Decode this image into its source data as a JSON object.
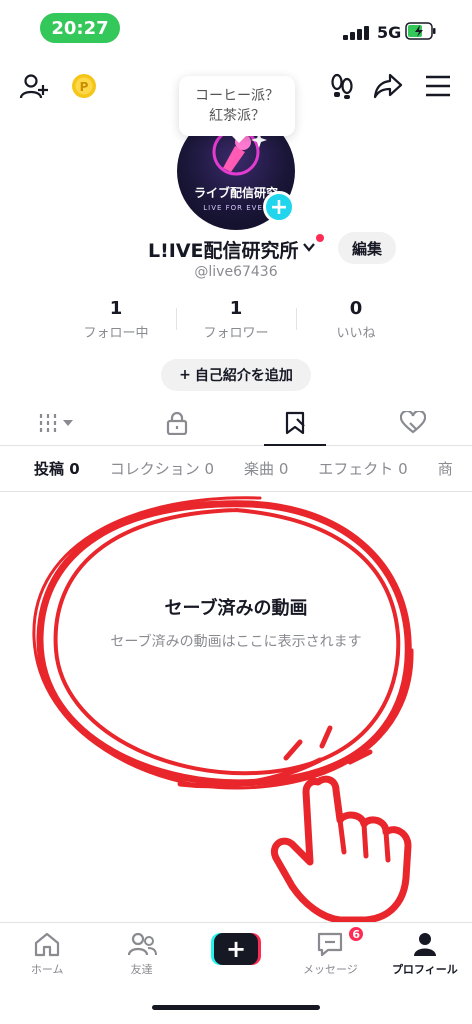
{
  "status_bar": {
    "time": "20:27",
    "network": "5G"
  },
  "bubble": {
    "line1": "コーヒー派？",
    "line2": "紅茶派？"
  },
  "avatar": {
    "title": "ライブ配信研究",
    "subtitle": "LIVE FOR EVER"
  },
  "profile": {
    "display_name": "L!IVE配信研究所",
    "handle": "@live67436",
    "edit_label": "編集",
    "add_bio_label": "自己紹介を追加"
  },
  "stats": [
    {
      "value": "1",
      "label": "フォロー中"
    },
    {
      "value": "1",
      "label": "フォロワー"
    },
    {
      "value": "0",
      "label": "いいね"
    }
  ],
  "sub_tabs": [
    {
      "label": "投稿",
      "count": "0"
    },
    {
      "label": "コレクション",
      "count": "0"
    },
    {
      "label": "楽曲",
      "count": "0"
    },
    {
      "label": "エフェクト",
      "count": "0"
    },
    {
      "label": "商",
      "count": ""
    }
  ],
  "empty_state": {
    "title": "セーブ済みの動画",
    "subtitle": "セーブ済みの動画はここに表示されます"
  },
  "tab_bar": {
    "home": "ホーム",
    "friends": "友達",
    "messages": "メッセージ",
    "messages_badge": "6",
    "profile": "プロフィール"
  },
  "colors": {
    "accent_red": "#fe2c55",
    "accent_cyan": "#20d5ec",
    "annotation_red": "#e8262b"
  }
}
